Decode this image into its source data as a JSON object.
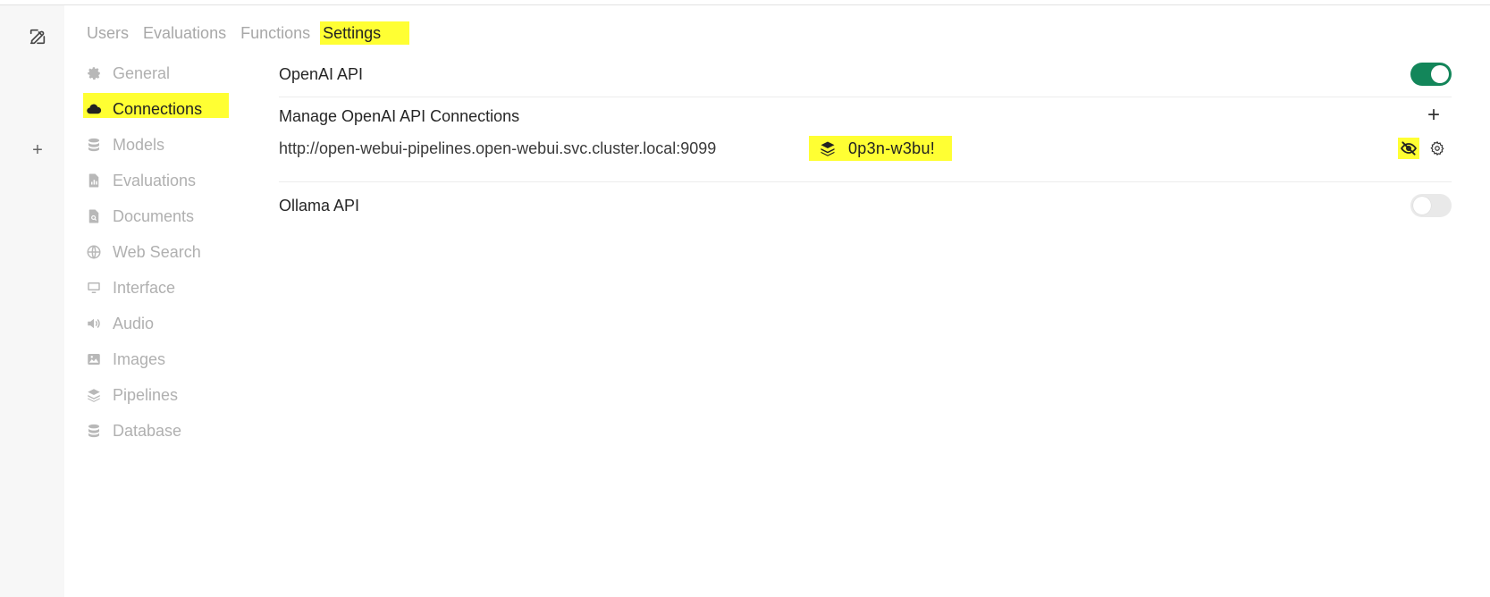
{
  "tabs": [
    {
      "label": "Users"
    },
    {
      "label": "Evaluations"
    },
    {
      "label": "Functions"
    },
    {
      "label": "Settings"
    }
  ],
  "sidebar": {
    "items": [
      {
        "label": "General",
        "icon": "gear-icon"
      },
      {
        "label": "Connections",
        "icon": "cloud-icon"
      },
      {
        "label": "Models",
        "icon": "database-icon"
      },
      {
        "label": "Evaluations",
        "icon": "document-chart-icon"
      },
      {
        "label": "Documents",
        "icon": "document-search-icon"
      },
      {
        "label": "Web Search",
        "icon": "globe-icon"
      },
      {
        "label": "Interface",
        "icon": "monitor-icon"
      },
      {
        "label": "Audio",
        "icon": "speaker-icon"
      },
      {
        "label": "Images",
        "icon": "image-icon"
      },
      {
        "label": "Pipelines",
        "icon": "layers-icon"
      },
      {
        "label": "Database",
        "icon": "database-icon"
      }
    ]
  },
  "main": {
    "openai": {
      "title": "OpenAI API",
      "enabled": true
    },
    "manage": {
      "title": "Manage OpenAI API Connections",
      "connection": {
        "url": "http://open-webui-pipelines.open-webui.svc.cluster.local:9099",
        "key": "0p3n-w3bu!"
      }
    },
    "ollama": {
      "title": "Ollama API",
      "enabled": false
    }
  },
  "colors": {
    "highlight": "#ffff33",
    "toggle_on": "#13865a",
    "toggle_off": "#e9e9e9"
  }
}
